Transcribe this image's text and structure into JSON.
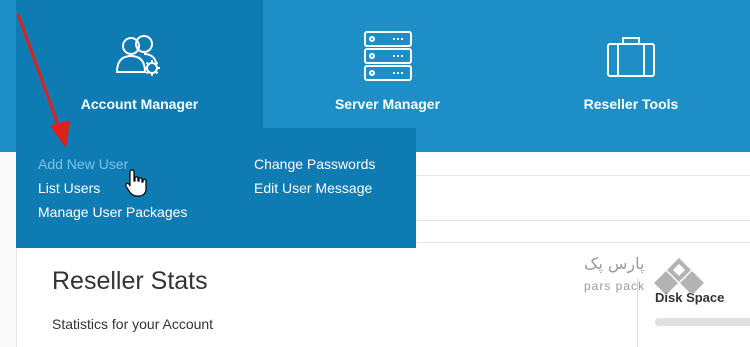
{
  "nav": {
    "items": [
      {
        "label": "Account Manager",
        "icon": "users-gear-icon"
      },
      {
        "label": "Server Manager",
        "icon": "server-stack-icon"
      },
      {
        "label": "Reseller Tools",
        "icon": "briefcase-icon"
      }
    ]
  },
  "dropdown": {
    "left": [
      "Add New User",
      "List Users",
      "Manage User Packages"
    ],
    "right": [
      "Change Passwords",
      "Edit User Message"
    ]
  },
  "stats": {
    "title": "Reseller Stats",
    "subtitle": "Statistics for your Account"
  },
  "side": {
    "title": "Disk Space"
  },
  "watermark": {
    "fa": "پارس پک",
    "en": "pars pack"
  },
  "colors": {
    "topbar": "#1e8fc6",
    "active": "#0f7bb3",
    "hover_link": "#7cc4e8",
    "arrow": "#e0201b"
  }
}
